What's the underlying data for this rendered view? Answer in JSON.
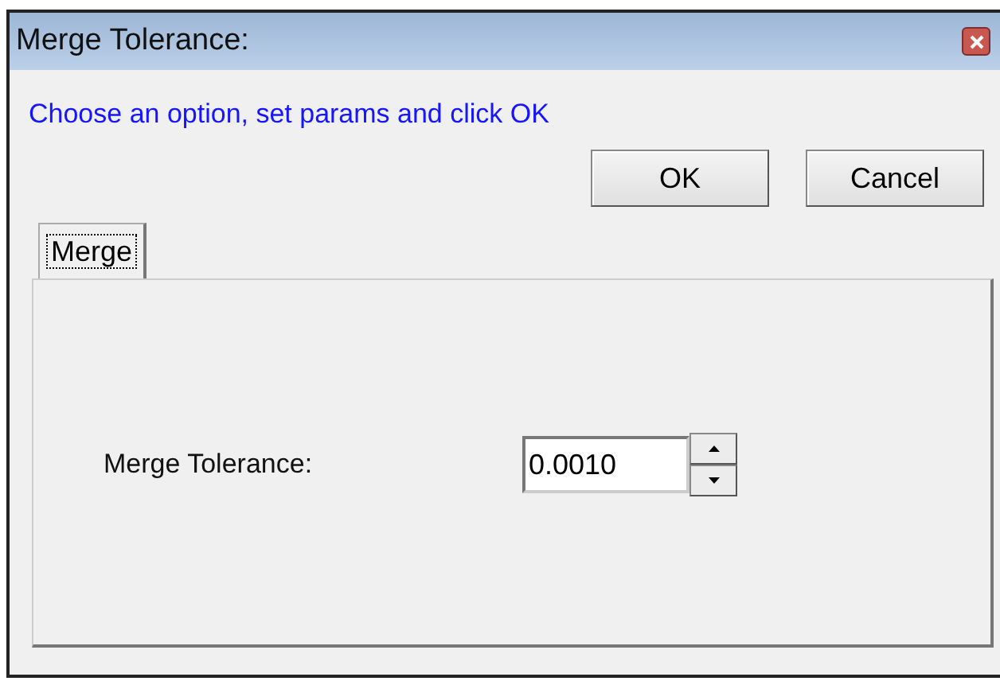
{
  "window": {
    "title": "Merge Tolerance:"
  },
  "instruction": "Choose an option, set params and click OK",
  "buttons": [
    "OK",
    "Cancel"
  ],
  "tabs": [
    {
      "label": "Merge",
      "selected": true
    }
  ],
  "field": {
    "label": "Merge Tolerance:",
    "value": "0.0010"
  }
}
